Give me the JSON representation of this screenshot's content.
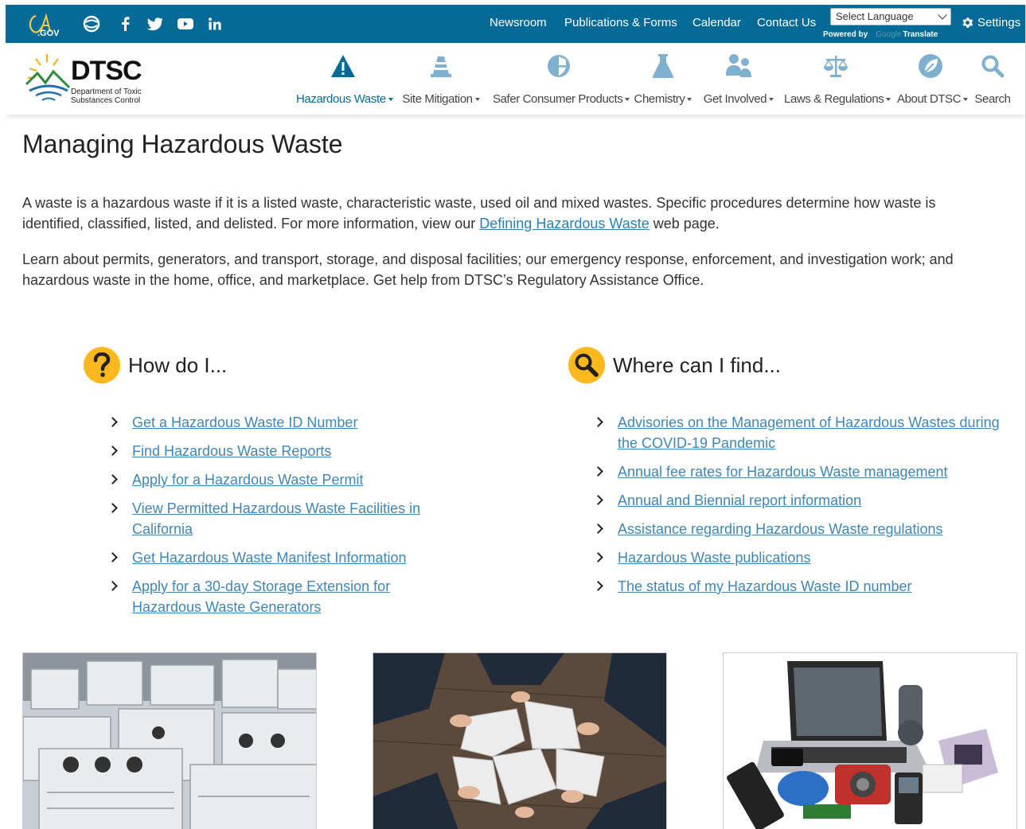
{
  "utility": {
    "ca_gov_logo_text": "CA.GOV",
    "social_icons": [
      "ca-seal-icon",
      "facebook-icon",
      "twitter-icon",
      "youtube-icon",
      "linkedin-icon"
    ],
    "links": [
      "Newsroom",
      "Publications & Forms",
      "Calendar",
      "Contact Us"
    ],
    "language_select_value": "Select Language",
    "powered_by": "Powered by",
    "google": "Google",
    "translate": "Translate",
    "settings_label": "Settings"
  },
  "header": {
    "logo_name": "DTSC",
    "logo_subtitle": "Department of Toxic Substances Control",
    "nav": [
      {
        "label": "Hazardous Waste",
        "icon": "warning-icon",
        "active": true
      },
      {
        "label": "Site Mitigation",
        "icon": "traffic-cone-icon",
        "active": false
      },
      {
        "label": "Safer Consumer Products",
        "icon": "shield-icon",
        "active": false
      },
      {
        "label": "Chemistry",
        "icon": "flask-icon",
        "active": false
      },
      {
        "label": "Get Involved",
        "icon": "people-icon",
        "active": false
      },
      {
        "label": "Laws & Regulations",
        "icon": "scales-icon",
        "active": false
      },
      {
        "label": "About DTSC",
        "icon": "leaf-icon",
        "active": false
      },
      {
        "label": "Search",
        "icon": "search-icon",
        "active": false
      }
    ]
  },
  "main": {
    "title": "Managing Hazardous Waste",
    "intro1_a": "A waste is a hazardous waste if it is a listed waste, characteristic waste, used oil and mixed wastes. Specific procedures determine how waste is identified, classified, listed, and delisted. For more information, view our ",
    "intro1_link": "Defining Hazardous Waste",
    "intro1_b": " web page.",
    "intro2": "Learn about permits, generators, and transport, storage, and disposal facilities; our emergency response, enforcement, and investigation work; and hazardous waste in the home, office, and marketplace. Get help from DTSC’s Regulatory Assistance Office.",
    "how_title": "How do I...",
    "how_items": [
      "Get a Hazardous Waste ID Number",
      "Find Hazardous Waste Reports",
      "Apply for a Hazardous Waste Permit",
      "View Permitted Hazardous Waste Facilities in California",
      "Get Hazardous Waste Manifest Information",
      "Apply for a 30-day Storage Extension for Hazardous Waste Generators"
    ],
    "where_title": "Where can I find...",
    "where_items": [
      "Advisories on the Management of Hazardous Wastes during the COVID-19 Pandemic",
      "Annual fee rates for Hazardous Waste management",
      "Annual and Biennial report information",
      "Assistance regarding Hazardous Waste regulations",
      "Hazardous Waste publications",
      "The status of my Hazardous Waste ID number"
    ],
    "photos": [
      "appliances-photo",
      "puzzle-photo",
      "electronics-photo"
    ]
  },
  "colors": {
    "utility_bar": "#046b99",
    "accent": "#fdb81e",
    "link": "#3f85b7"
  }
}
